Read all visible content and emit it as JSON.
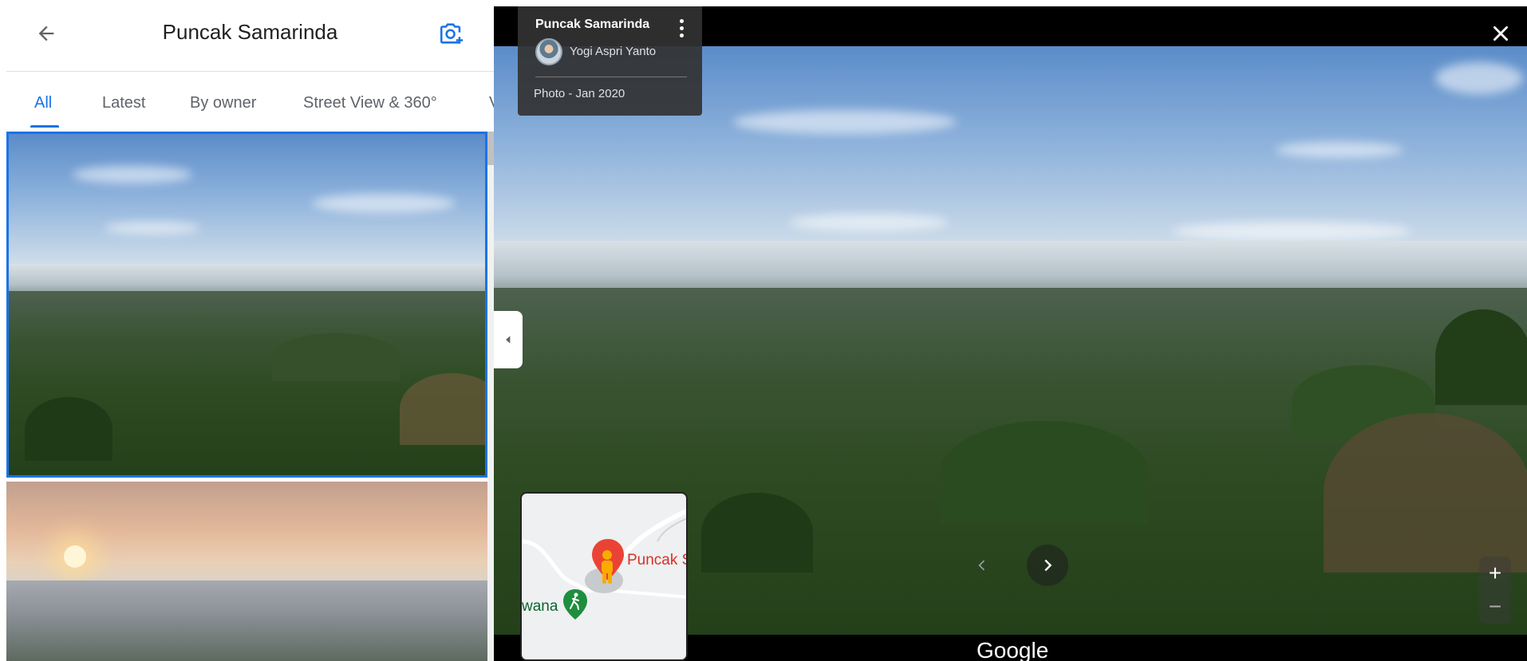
{
  "header": {
    "title": "Puncak Samarinda",
    "back_icon": "arrow-back-icon",
    "add_photo_icon": "add-photo-camera-icon"
  },
  "tabs": [
    {
      "label": "All",
      "active": true
    },
    {
      "label": "Latest",
      "active": false
    },
    {
      "label": "By owner",
      "active": false
    },
    {
      "label": "Street View & 360°",
      "active": false
    },
    {
      "label": "V",
      "active": false
    }
  ],
  "info_card": {
    "title": "Puncak Samarinda",
    "author": "Yogi Aspri Yanto",
    "date": "Photo - Jan 2020"
  },
  "minimap": {
    "place_label": "Puncak S",
    "nearby_label": "wana"
  },
  "footer": {
    "logo": "Google"
  },
  "zoom": {
    "in": "+",
    "out": "−"
  },
  "colors": {
    "accent": "#1a73e8",
    "pin_red": "#d93025",
    "park_green": "#0d652d"
  }
}
